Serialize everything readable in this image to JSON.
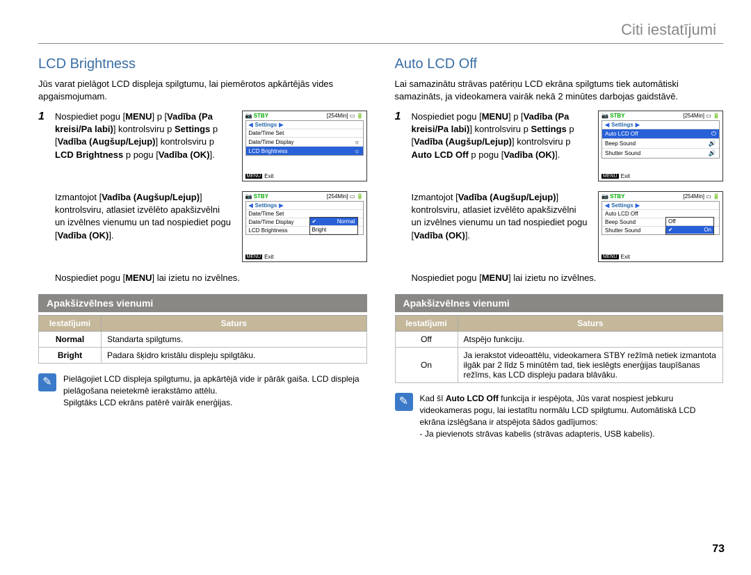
{
  "page": {
    "top_title": "Citi iestatījumi",
    "number": "73"
  },
  "left": {
    "heading": "LCD Brightness",
    "intro": "Jūs varat pielāgot LCD displeja spilgtumu, lai piemērotos apkārtējās vides apgaismojumam.",
    "steps": {
      "s1_num": "1",
      "s1_html": "Nospiediet pogu [<b>MENU</b>] p [<b>Vadība (Pa kreisi/Pa labi)</b>] kontrolsviru p <b>Settings</b> p [<b>Vadība (Augšup/Lejup)</b>] kontrolsviru p <b>LCD Brightness</b> p pogu [<b>Vadība (OK)</b>].",
      "s2_html": "Izmantojot [<b>Vadība (Augšup/Lejup)</b>] kontrolsviru, atlasiet izvēlēto apakšizvēlni un izvēlnes vienumu un tad nospiediet pogu [<b>Vadība (OK)</b>].",
      "s3_html": "Nospiediet pogu [<b>MENU</b>] lai izietu no izvēlnes."
    },
    "submenu_label": "Apakšizvēlnes vienumi",
    "table": {
      "h1": "Iestatījumi",
      "h2": "Saturs",
      "r1k": "Normal",
      "r1v": "Standarta spilgtums.",
      "r2k": "Bright",
      "r2v": "Padara šķidro kristālu displeju spilgtāku."
    },
    "note": "Pielāgojiet LCD displeja spilgtumu, ja apkārtējā vide ir pārāk gaiša. LCD displeja pielāgošana neietekmē ierakstāmo attēlu.\nSpilgtāks LCD ekrāns patērē vairāk enerģijas.",
    "lcd1": {
      "stby": "STBY",
      "time": "[254Min]",
      "header": "Settings",
      "item1": "Date/Time Set",
      "item2": "Date/Time Display",
      "item3": "LCD Brightness",
      "exit": "Exit",
      "menu": "MENU"
    },
    "lcd2": {
      "stby": "STBY",
      "time": "[254Min]",
      "header": "Settings",
      "item1": "Date/Time Set",
      "item2": "Date/Time Display",
      "item3": "LCD Brightness",
      "popup1": "Normal",
      "popup2": "Bright",
      "exit": "Exit",
      "menu": "MENU"
    }
  },
  "right": {
    "heading": "Auto LCD Off",
    "intro": "Lai samazinātu strāvas patēriņu LCD ekrāna spilgtums tiek automātiski samazināts, ja videokamera vairāk nekā 2 minūtes darbojas gaidstāvē.",
    "steps": {
      "s1_num": "1",
      "s1_html": "Nospiediet pogu [<b>MENU</b>] p [<b>Vadība (Pa kreisi/Pa labi)</b>] kontrolsviru p <b>Settings</b> p [<b>Vadība (Augšup/Lejup)</b>] kontrolsviru p <b>Auto LCD Off</b> p pogu [<b>Vadība (OK)</b>].",
      "s2_html": "Izmantojot [<b>Vadība (Augšup/Lejup)</b>] kontrolsviru, atlasiet izvēlēto apakšizvēlni un izvēlnes vienumu un tad nospiediet pogu [<b>Vadība (OK)</b>].",
      "s3_html": "Nospiediet pogu [<b>MENU</b>] lai izietu no izvēlnes."
    },
    "submenu_label": "Apakšizvēlnes vienumi",
    "table": {
      "h1": "Iestatījumi",
      "h2": "Saturs",
      "r1k": "Off",
      "r1v": "Atspējo funkciju.",
      "r2k": "On",
      "r2v": "Ja ierakstot videoattēlu, videokamera STBY režīmā netiek izmantota ilgāk par 2 līdz 5 minūtēm tad, tiek ieslēgts enerģijas taupīšanas režīms, kas LCD displeju padara blāvāku."
    },
    "note_html": "Kad šī <b>Auto LCD Off</b> funkcija ir iespējota, Jūs varat nospiest jebkuru videokameras pogu, lai iestatītu normālu LCD spilgtumu. Automātiskā LCD ekrāna izslēgšana ir atspējota šādos gadījumos:\n- Ja pievienots strāvas kabelis (strāvas adapteris, USB kabelis).",
    "lcd1": {
      "stby": "STBY",
      "time": "[254Min]",
      "header": "Settings",
      "item1": "Auto LCD Off",
      "item2": "Beep Sound",
      "item3": "Shutter Sound",
      "exit": "Exit",
      "menu": "MENU"
    },
    "lcd2": {
      "stby": "STBY",
      "time": "[254Min]",
      "header": "Settings",
      "item1": "Auto LCD Off",
      "item2": "Beep Sound",
      "item3": "Shutter Sound",
      "popup1": "Off",
      "popup2": "On",
      "exit": "Exit",
      "menu": "MENU"
    }
  }
}
